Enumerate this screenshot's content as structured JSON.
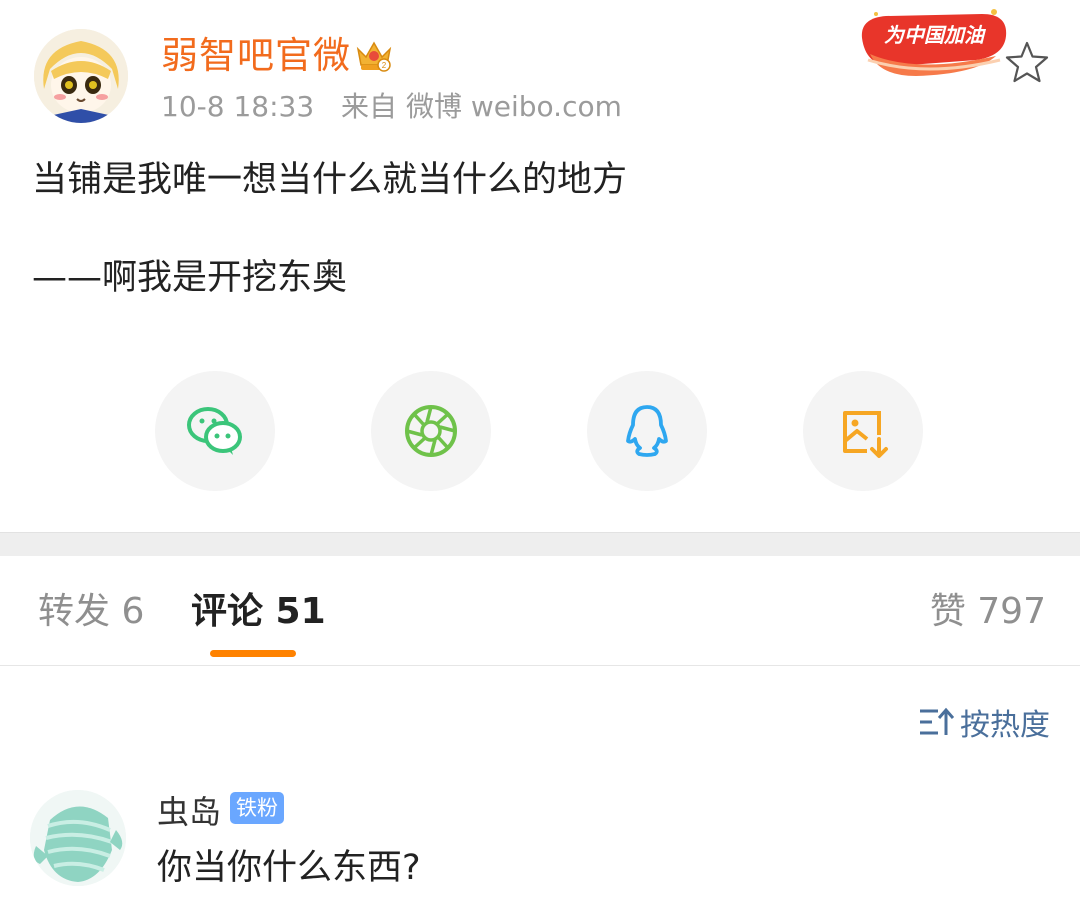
{
  "post": {
    "author": "弱智吧官微",
    "time": "10-8 18:33",
    "source": "来自 微博 weibo.com",
    "cheer_badge": "为中国加油",
    "lines": [
      "当铺是我唯一想当什么就当什么的地方",
      "——啊我是开挖东奥"
    ]
  },
  "share_icons": [
    "wechat-icon",
    "moments-icon",
    "qq-icon",
    "save-image-icon"
  ],
  "tabs": {
    "repost": "转发 6",
    "comment": "评论 51",
    "like": "赞 797"
  },
  "sort": {
    "label": "按热度",
    "icon": "sort-icon"
  },
  "comment": {
    "name": "虫岛",
    "badge": "铁粉",
    "text": "你当你什么东西?"
  },
  "colors": {
    "author": "#f26b1d",
    "accent": "#ff8200",
    "link": "#4a6f9b",
    "badge": "#6aa7ff"
  }
}
